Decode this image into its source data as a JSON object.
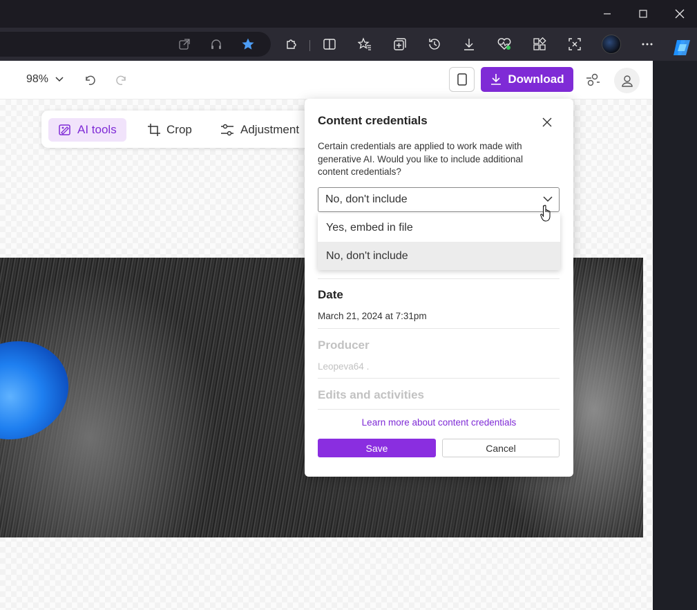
{
  "colors": {
    "accent": "#7f2bd6",
    "chrome_dark": "#1c1b22",
    "toolbar": "#2b2a33"
  },
  "window_controls": [
    "minimize-icon",
    "maximize-icon",
    "close-icon"
  ],
  "browser_toolbar": {
    "icons": [
      "open-in-new-window-icon",
      "read-aloud-icon",
      "favorite-star-icon",
      "extensions-icon",
      "split-screen-icon",
      "favorites-icon",
      "collections-icon",
      "history-icon",
      "downloads-icon",
      "browser-essentials-icon",
      "apps-icon",
      "screenshot-icon",
      "profile-avatar",
      "more-options-icon",
      "copilot-icon"
    ]
  },
  "app_header": {
    "zoom": "98%",
    "download_label": "Download"
  },
  "tools": [
    {
      "label": "AI tools",
      "icon": "ai-image-icon",
      "active": true
    },
    {
      "label": "Crop",
      "icon": "crop-icon",
      "active": false
    },
    {
      "label": "Adjustment",
      "icon": "sliders-icon",
      "active": false
    }
  ],
  "popup": {
    "title": "Content credentials",
    "description": "Certain credentials are applied to work made with generative AI. Would you like to include additional content credentials?",
    "select_value": "No, don't include",
    "options": [
      "Yes, embed in file",
      "No, don't include"
    ],
    "selected_option_index": 1,
    "date_label": "Date",
    "date_value": "March 21, 2024 at 7:31pm",
    "producer_label": "Producer",
    "producer_value": "Leopeva64 .",
    "edits_label": "Edits and activities",
    "learn_more": "Learn more about content credentials",
    "save_label": "Save",
    "cancel_label": "Cancel"
  }
}
